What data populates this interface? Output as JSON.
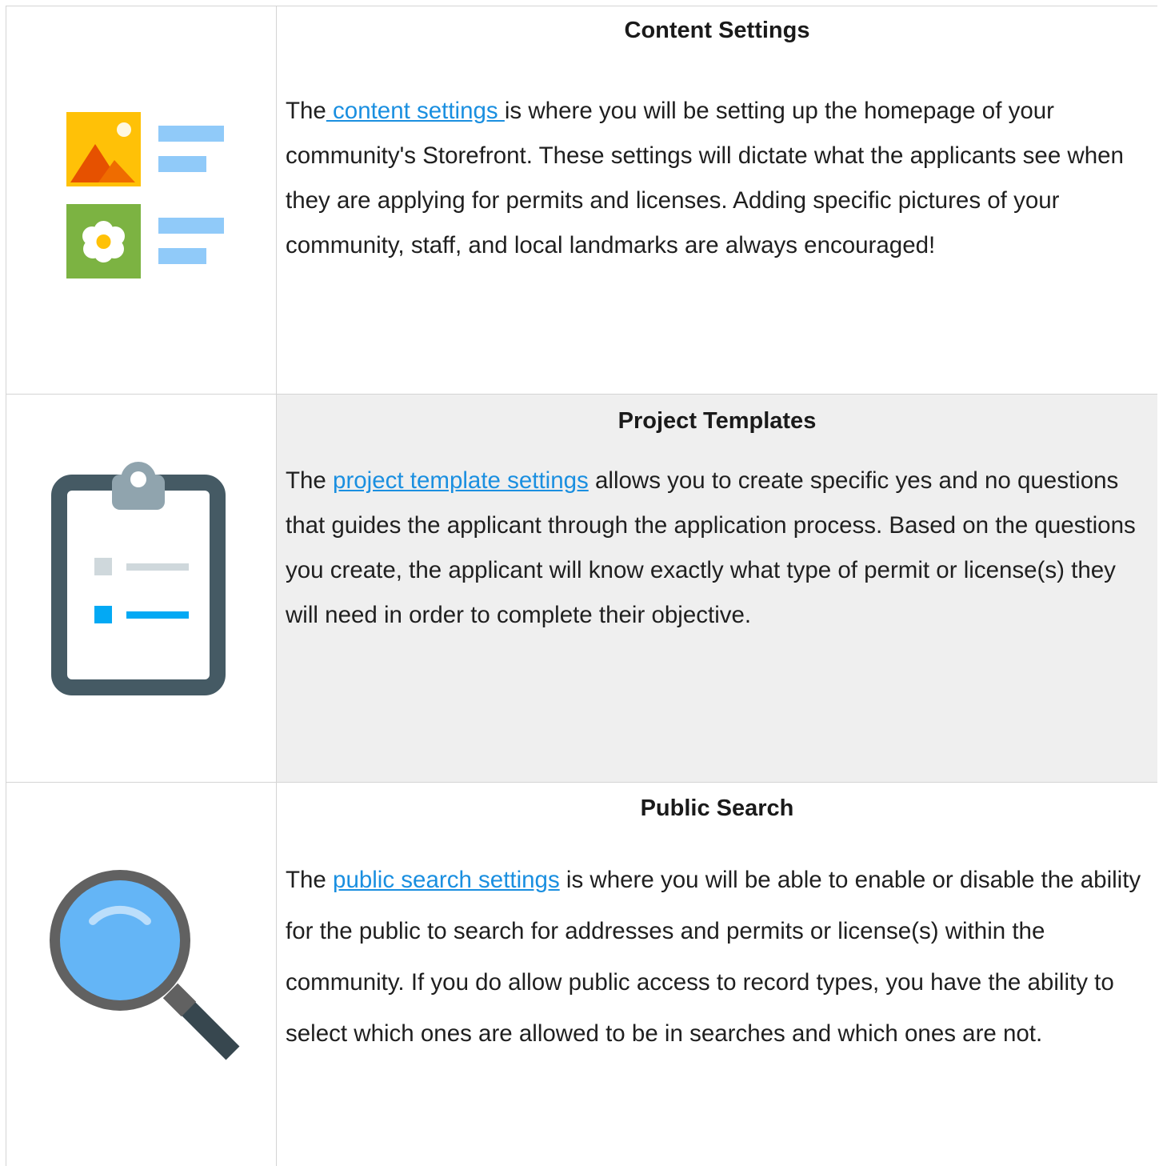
{
  "rows": [
    {
      "icon": "image-text-icon",
      "title": "Content Settings",
      "intro": "The",
      "link": " content settings ",
      "text": "is where you will be setting up the homepage of your community's Storefront. These settings will dictate what the applicants see when they are applying for permits and licenses. Adding specific pictures of your community, staff, and local landmarks are always encouraged!"
    },
    {
      "icon": "clipboard-icon",
      "title": "Project Templates",
      "intro": "The ",
      "link": "project template settings",
      "text": " allows you to create specific yes and no questions that guides the applicant through the application process. Based on the questions you create, the applicant will know exactly what type of permit or license(s) they will need in order to complete their objective."
    },
    {
      "icon": "magnifier-icon",
      "title": "Public Search",
      "intro": "The ",
      "link": "public search settings",
      "text": " is where you will be able to enable or disable the ability for the public to search for addresses and permits or license(s) within the community. If you do allow public access to record types, you have the ability to select which ones are allowed to be in searches and which ones are not."
    }
  ],
  "colors": {
    "link": "#1a8fe0",
    "border": "#d4d4d4",
    "highlight_row": "#efefef"
  }
}
